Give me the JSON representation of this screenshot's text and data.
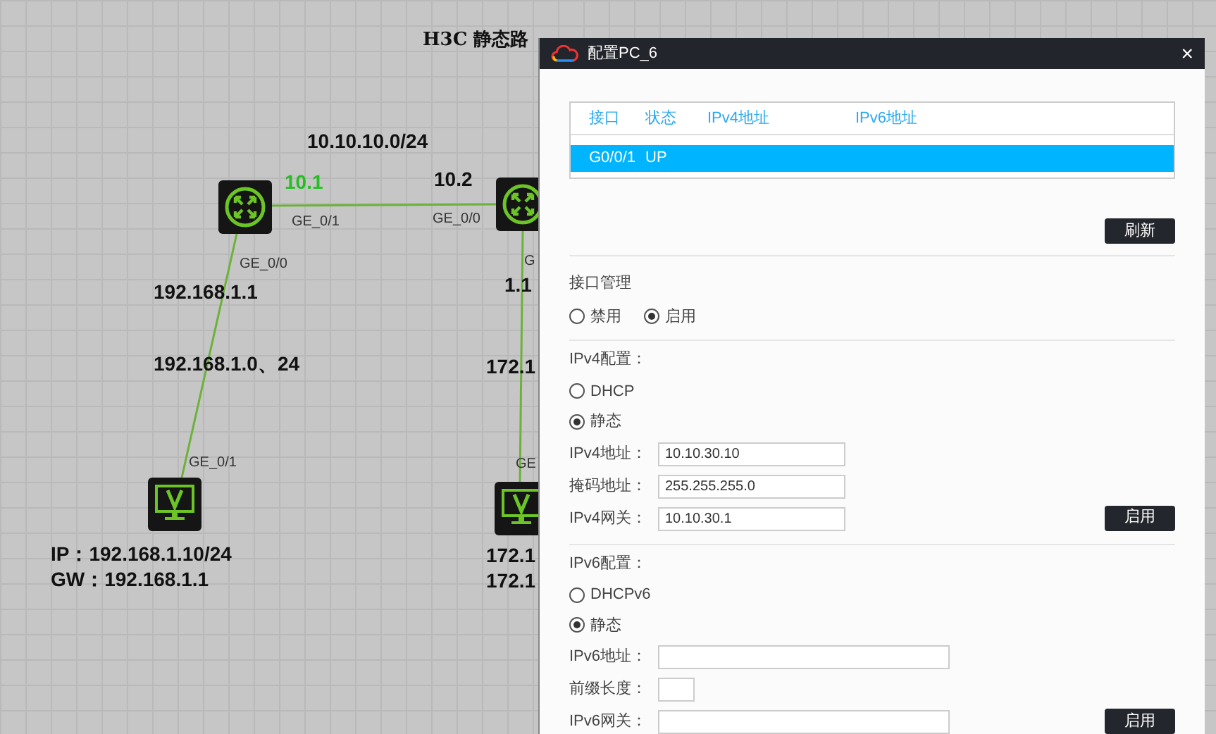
{
  "canvas": {
    "title": "H3C 静态路",
    "devices": [
      {
        "kind": "router"
      },
      {
        "kind": "router"
      },
      {
        "kind": "pc"
      },
      {
        "kind": "pc"
      }
    ],
    "labels": [
      {
        "text": "10.10.10.0/24",
        "kind": "ip"
      },
      {
        "text": "10.1",
        "kind": "highlight"
      },
      {
        "text": "10.2",
        "kind": "ip"
      },
      {
        "text": "GE_0/1",
        "kind": "port"
      },
      {
        "text": "GE_0/0",
        "kind": "port"
      },
      {
        "text": "GE_0/0",
        "kind": "port"
      },
      {
        "text": "192.168.1.1",
        "kind": "ip"
      },
      {
        "text": "192.168.1.0、24",
        "kind": "ip"
      },
      {
        "text": "GE_0/1",
        "kind": "port"
      },
      {
        "text": "IP：192.168.1.10/24",
        "kind": "ip"
      },
      {
        "text": "GW：192.168.1.1",
        "kind": "ip"
      },
      {
        "text": "G",
        "kind": "port"
      },
      {
        "text": "1.1",
        "kind": "ip"
      },
      {
        "text": "172.1",
        "kind": "ip"
      },
      {
        "text": "GE",
        "kind": "port"
      },
      {
        "text": "172.1",
        "kind": "ip"
      },
      {
        "text": "172.1",
        "kind": "ip"
      }
    ]
  },
  "dialog": {
    "title": "配置PC_6",
    "close": "×",
    "table": {
      "columns": [
        "接口",
        "状态",
        "IPv4地址",
        "IPv6地址"
      ],
      "rows": [
        {
          "cells": [
            "G0/0/1",
            "UP"
          ],
          "selected": true
        }
      ]
    },
    "refresh_button": "刷新",
    "interface": {
      "heading": "接口管理",
      "options": [
        {
          "label": "禁用",
          "selected": false
        },
        {
          "label": "启用",
          "selected": true
        }
      ]
    },
    "sections": [
      {
        "heading": "IPv4配置：",
        "modes": [
          {
            "label": "DHCP",
            "selected": false
          },
          {
            "label": "静态",
            "selected": true
          }
        ],
        "fields": [
          {
            "label": "IPv4地址：",
            "value": "10.10.30.10",
            "kind": "text"
          },
          {
            "label": "掩码地址：",
            "value": "255.255.255.0",
            "kind": "text"
          },
          {
            "label": "IPv4网关：",
            "value": "10.10.30.1",
            "kind": "text"
          }
        ],
        "button": "启用"
      },
      {
        "heading": "IPv6配置：",
        "modes": [
          {
            "label": "DHCPv6",
            "selected": false
          },
          {
            "label": "静态",
            "selected": true
          }
        ],
        "fields": [
          {
            "label": "IPv6地址：",
            "kind": "wide"
          },
          {
            "label": "前缀长度：",
            "kind": "number"
          },
          {
            "label": "IPv6网关：",
            "kind": "wide"
          }
        ],
        "button": "启用"
      }
    ]
  }
}
